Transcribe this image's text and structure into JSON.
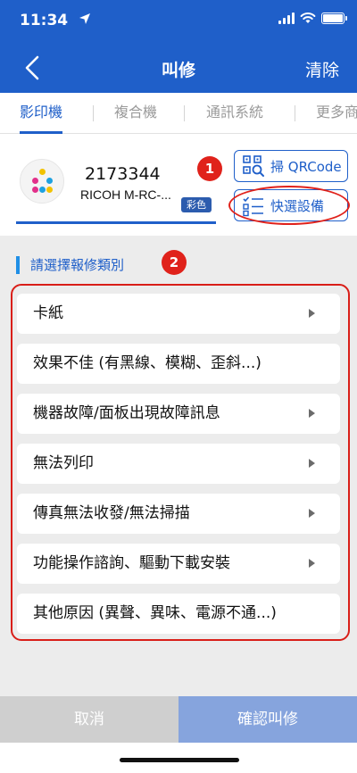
{
  "status_bar": {
    "time": "11:34",
    "location_icon": "location-arrow-icon",
    "signal_icon": "cellular-signal-icon",
    "wifi_icon": "wifi-icon",
    "battery_icon": "battery-icon"
  },
  "nav": {
    "back_icon": "chevron-left-icon",
    "title": "叫修",
    "clear_label": "清除"
  },
  "tabs": [
    {
      "label": "影印機",
      "active": true
    },
    {
      "label": "複合機",
      "active": false
    },
    {
      "label": "通訊系統",
      "active": false
    },
    {
      "label": "更多商",
      "active": false
    }
  ],
  "device": {
    "number": "2173344",
    "model": "RICOH M-RC-...",
    "color_badge": "彩色",
    "dot_colors": [
      "#f2c200",
      "#e2318a",
      "#1da1e0",
      "#e2318a",
      "#1da1e0",
      "#f2c200"
    ]
  },
  "buttons": {
    "qr_label": "掃 QRCode",
    "qr_icon": "qr-scan-icon",
    "quick_label": "快選設備",
    "quick_icon": "checklist-icon"
  },
  "annotations": {
    "badge1": "1",
    "badge2": "2",
    "color": "#e0221b"
  },
  "section": {
    "title": "請選擇報修類別"
  },
  "categories": [
    {
      "label": "卡紙",
      "chevron": true
    },
    {
      "label": "效果不佳 (有黑線、模糊、歪斜...)",
      "chevron": false
    },
    {
      "label": "機器故障/面板出現故障訊息",
      "chevron": true
    },
    {
      "label": "無法列印",
      "chevron": true
    },
    {
      "label": "傳真無法收發/無法掃描",
      "chevron": true
    },
    {
      "label": "功能操作諮詢、驅動下載安裝",
      "chevron": true
    },
    {
      "label": "其他原因 (異聲、異味、電源不通...)",
      "chevron": false
    }
  ],
  "footer": {
    "cancel_label": "取消",
    "confirm_label": "確認叫修"
  },
  "colors": {
    "primary": "#1f5fc9",
    "confirm_disabled": "#86a4dd",
    "cancel_disabled": "#cfcfcf",
    "annotation_red": "#e0221b"
  }
}
